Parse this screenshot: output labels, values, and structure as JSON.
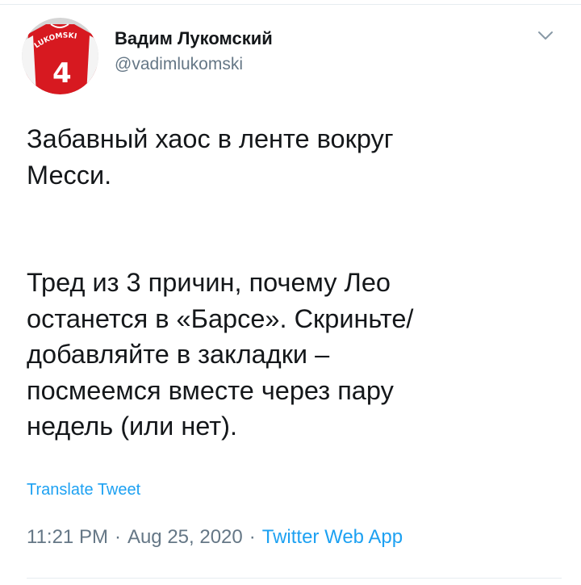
{
  "author": {
    "display_name": "Вадим Лукомский",
    "handle": "@vadimlukomski",
    "avatar_jersey_text": "LUKOMSKI",
    "avatar_jersey_number": "4"
  },
  "tweet": {
    "paragraph1": [
      "Забавный хаос в ленте вокруг",
      "Месси."
    ],
    "paragraph2": [
      "Тред из 3 причин, почему Лео",
      "останется в «Барсе». Скриньте/",
      "добавляйте в закладки –",
      "посмеемся вместе через пару",
      "недель (или нет)."
    ],
    "translate_label": "Translate Tweet"
  },
  "meta": {
    "time": "11:21 PM",
    "separator": "·",
    "date": "Aug 25, 2020",
    "source": "Twitter Web App"
  },
  "colors": {
    "text": "#14171a",
    "secondary": "#657786",
    "link": "#1da1f2",
    "jersey_red": "#d71920",
    "divider": "#e6ecf0"
  },
  "icons": {
    "caret": "chevron-down-icon"
  }
}
